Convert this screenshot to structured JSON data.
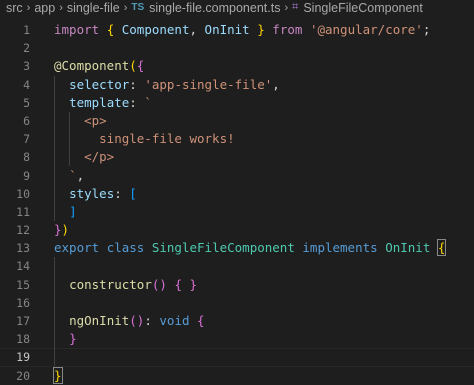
{
  "breadcrumb": {
    "items": [
      "src",
      "app",
      "single-file"
    ],
    "file_badge": "TS",
    "file": "single-file.component.ts",
    "symbol": "SingleFileComponent"
  },
  "editor": {
    "lines": [
      {
        "n": "1",
        "tokens": [
          [
            "kw-ctl",
            "import"
          ],
          [
            "p",
            " "
          ],
          [
            "br1",
            "{"
          ],
          [
            "p",
            " "
          ],
          [
            "prop",
            "Component"
          ],
          [
            "p",
            ", "
          ],
          [
            "prop",
            "OnInit"
          ],
          [
            "p",
            " "
          ],
          [
            "br1",
            "}"
          ],
          [
            "p",
            " "
          ],
          [
            "ctl",
            "from"
          ],
          [
            "p",
            " "
          ],
          [
            "str",
            "'@angular/core'"
          ],
          [
            "p",
            ";"
          ]
        ]
      },
      {
        "n": "2",
        "tokens": []
      },
      {
        "n": "3",
        "tokens": [
          [
            "fn",
            "@Component"
          ],
          [
            "br1",
            "("
          ],
          [
            "br2",
            "{"
          ]
        ]
      },
      {
        "n": "4",
        "tokens": [
          [
            "p",
            "  "
          ],
          [
            "prop",
            "selector"
          ],
          [
            "p",
            ": "
          ],
          [
            "str",
            "'app-single-file'"
          ],
          [
            "p",
            ","
          ]
        ]
      },
      {
        "n": "5",
        "tokens": [
          [
            "p",
            "  "
          ],
          [
            "prop",
            "template"
          ],
          [
            "p",
            ": "
          ],
          [
            "str",
            "`"
          ]
        ]
      },
      {
        "n": "6",
        "tokens": [
          [
            "p",
            "    "
          ],
          [
            "str",
            "<p>"
          ]
        ]
      },
      {
        "n": "7",
        "tokens": [
          [
            "p",
            "      "
          ],
          [
            "str",
            "single-file works!"
          ]
        ]
      },
      {
        "n": "8",
        "tokens": [
          [
            "p",
            "    "
          ],
          [
            "str",
            "</p>"
          ]
        ]
      },
      {
        "n": "9",
        "tokens": [
          [
            "p",
            "  "
          ],
          [
            "str",
            "`"
          ],
          [
            "p",
            ","
          ]
        ]
      },
      {
        "n": "10",
        "tokens": [
          [
            "p",
            "  "
          ],
          [
            "prop",
            "styles"
          ],
          [
            "p",
            ": "
          ],
          [
            "br3",
            "["
          ]
        ]
      },
      {
        "n": "11",
        "tokens": [
          [
            "p",
            "  "
          ],
          [
            "br3",
            "]"
          ]
        ]
      },
      {
        "n": "12",
        "tokens": [
          [
            "br2",
            "}"
          ],
          [
            "br1",
            ")"
          ]
        ]
      },
      {
        "n": "13",
        "tokens": [
          [
            "kw",
            "export"
          ],
          [
            "p",
            " "
          ],
          [
            "kw",
            "class"
          ],
          [
            "p",
            " "
          ],
          [
            "cls",
            "SingleFileComponent"
          ],
          [
            "p",
            " "
          ],
          [
            "kw",
            "implements"
          ],
          [
            "p",
            " "
          ],
          [
            "cls",
            "OnInit"
          ],
          [
            "p",
            " "
          ],
          [
            "br1-match",
            "{"
          ]
        ]
      },
      {
        "n": "14",
        "tokens": []
      },
      {
        "n": "15",
        "tokens": [
          [
            "p",
            "  "
          ],
          [
            "fn",
            "constructor"
          ],
          [
            "br2",
            "()"
          ],
          [
            "p",
            " "
          ],
          [
            "br2",
            "{"
          ],
          [
            "p",
            " "
          ],
          [
            "br2",
            "}"
          ]
        ]
      },
      {
        "n": "16",
        "tokens": []
      },
      {
        "n": "17",
        "tokens": [
          [
            "p",
            "  "
          ],
          [
            "fn",
            "ngOnInit"
          ],
          [
            "br2",
            "()"
          ],
          [
            "p",
            ": "
          ],
          [
            "kw",
            "void"
          ],
          [
            "p",
            " "
          ],
          [
            "br2",
            "{"
          ]
        ]
      },
      {
        "n": "18",
        "tokens": [
          [
            "p",
            "  "
          ],
          [
            "br2",
            "}"
          ]
        ]
      },
      {
        "n": "19",
        "tokens": []
      },
      {
        "n": "20",
        "tokens": [
          [
            "br1-match-cursor",
            "}"
          ]
        ]
      }
    ]
  }
}
